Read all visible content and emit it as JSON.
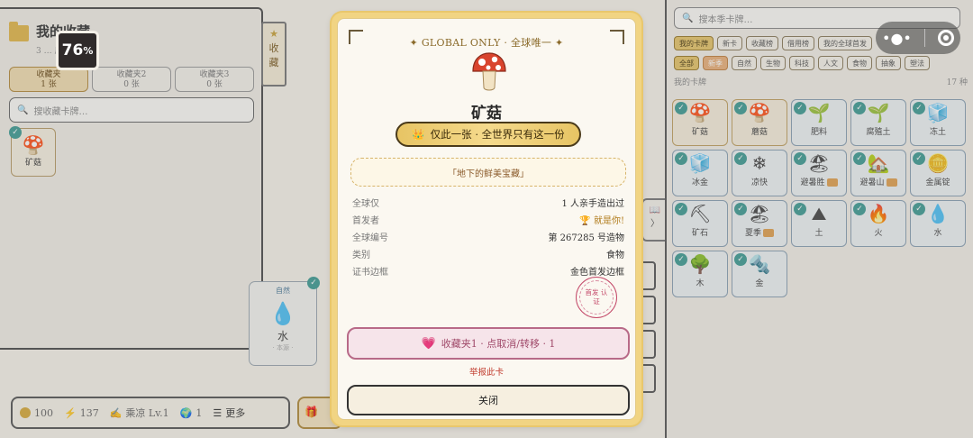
{
  "left": {
    "title": "我的收藏",
    "subtitle": "3 … 后点卡取出",
    "tabs": [
      {
        "label": "收藏夹",
        "count": "1 张"
      },
      {
        "label": "收藏夹2",
        "count": "0 张"
      },
      {
        "label": "收藏夹3",
        "count": "0 张"
      }
    ],
    "search_placeholder": "搜收藏卡牌…",
    "mini_card_label": "矿菇",
    "side_tab": "收藏"
  },
  "zoom": {
    "value": "76",
    "unit": "%"
  },
  "water_card": {
    "category": "自然",
    "name": "水",
    "sub": "· 本源 ·"
  },
  "stats": {
    "coins": "100",
    "energy": "137",
    "level": "乘凉 Lv.1",
    "globe": "1",
    "more": "更多"
  },
  "gift_label": "礼",
  "right": {
    "search_placeholder": "搜本季卡牌…",
    "tabs": [
      "我的卡牌",
      "新卡",
      "收藏榜",
      "借用榜",
      "我的全球首发"
    ],
    "filters": [
      "全部",
      "新季",
      "自然",
      "生物",
      "科技",
      "人文",
      "食物",
      "抽象",
      "塑法"
    ],
    "section_label": "我的卡牌",
    "count": "17 种",
    "cards": [
      {
        "icon": "🍄",
        "name": "矿菇"
      },
      {
        "icon": "🍄",
        "name": "蘑菇"
      },
      {
        "icon": "🌱",
        "name": "肥料"
      },
      {
        "icon": "🌱",
        "name": "腐殖土"
      },
      {
        "icon": "🧊",
        "name": "冻土"
      },
      {
        "icon": "🧊",
        "name": "冰金"
      },
      {
        "icon": "❄",
        "name": "凉快"
      },
      {
        "icon": "🏖",
        "name": "避暑胜"
      },
      {
        "icon": "🏡",
        "name": "避暑山"
      },
      {
        "icon": "🪙",
        "name": "金属锭"
      },
      {
        "icon": "⛏",
        "name": "矿石"
      },
      {
        "icon": "🏖",
        "name": "夏季"
      },
      {
        "icon": "⛰",
        "name": "土"
      },
      {
        "icon": "🔥",
        "name": "火"
      },
      {
        "icon": "💧",
        "name": "水"
      },
      {
        "icon": "🌳",
        "name": "木"
      },
      {
        "icon": "🔩",
        "name": "金"
      }
    ]
  },
  "modal": {
    "global_line": "✦ GLOBAL ONLY · 全球唯一 ✦",
    "card_name": "矿菇",
    "unique_banner": "仅此一张 · 全世界只有这一份",
    "description": "「地下的鲜美宝藏」",
    "rows": [
      {
        "key": "全球仅",
        "value": "1 人亲手造出过"
      },
      {
        "key": "首发者",
        "value": "🏆 就是你!"
      },
      {
        "key": "全球编号",
        "value": "第 267285 号造物"
      },
      {
        "key": "类别",
        "value": "食物"
      },
      {
        "key": "证书边框",
        "value": "金色首发边框"
      }
    ],
    "seal_text": "首发 认证",
    "fav_status": "收藏夹1 · 点取消/转移 · 1",
    "report": "举报此卡",
    "close": "关闭"
  }
}
